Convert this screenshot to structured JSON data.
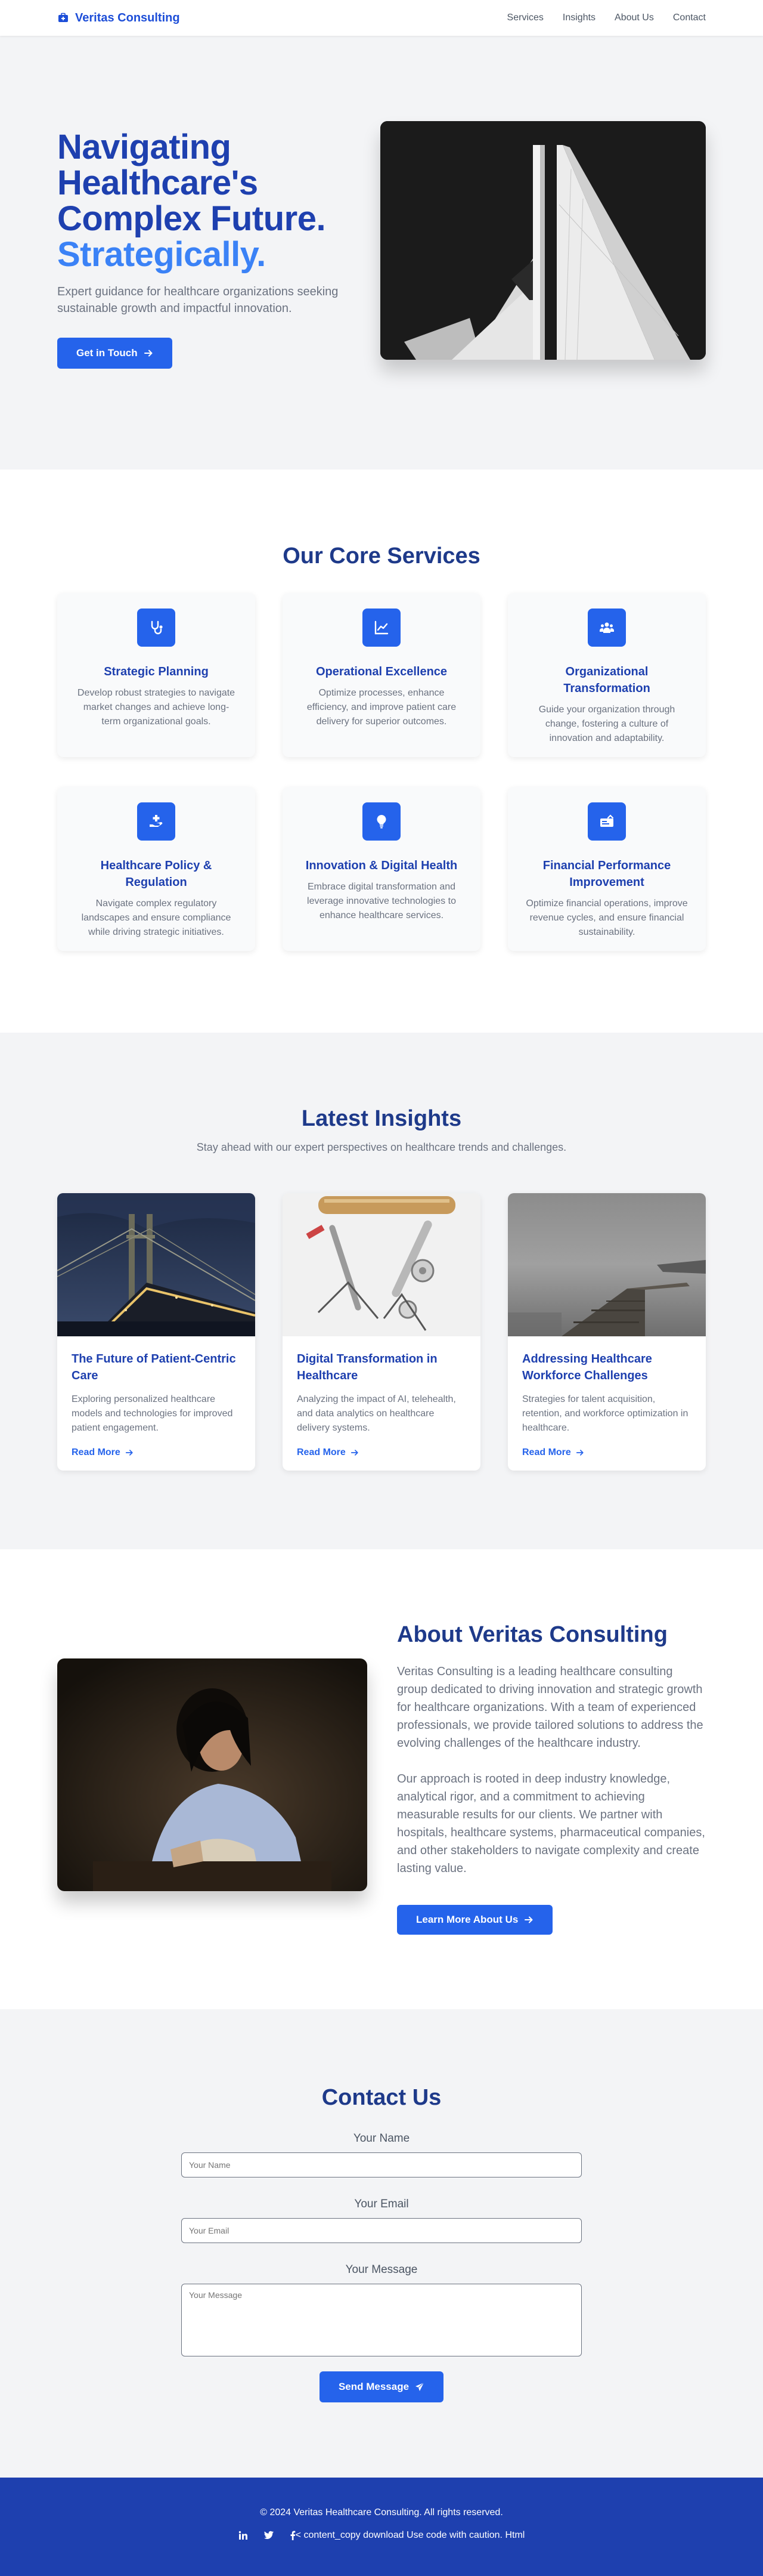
{
  "nav": {
    "brand": "Veritas Consulting",
    "links": [
      "Services",
      "Insights",
      "About Us",
      "Contact"
    ]
  },
  "hero": {
    "title": "Navigating Healthcare's Complex Future.",
    "title_accent": "Strategically.",
    "subtitle": "Expert guidance for healthcare organizations seeking sustainable growth and impactful innovation.",
    "cta": "Get in Touch"
  },
  "services": {
    "title": "Our Core Services",
    "items": [
      {
        "title": "Strategic Planning",
        "desc": "Develop robust strategies to navigate market changes and achieve long-term organizational goals.",
        "icon": "stethoscope-icon"
      },
      {
        "title": "Operational Excellence",
        "desc": "Optimize processes, enhance efficiency, and improve patient care delivery for superior outcomes.",
        "icon": "chart-line-icon"
      },
      {
        "title": "Organizational Transformation",
        "desc": "Guide your organization through change, fostering a culture of innovation and adaptability.",
        "icon": "people-group-icon"
      },
      {
        "title": "Healthcare Policy & Regulation",
        "desc": "Navigate complex regulatory landscapes and ensure compliance while driving strategic initiatives.",
        "icon": "hand-holding-medical-icon"
      },
      {
        "title": "Innovation & Digital Health",
        "desc": "Embrace digital transformation and leverage innovative technologies to enhance healthcare services.",
        "icon": "lightbulb-icon"
      },
      {
        "title": "Financial Performance Improvement",
        "desc": "Optimize financial operations, improve revenue cycles, and ensure financial sustainability.",
        "icon": "money-check-icon"
      }
    ]
  },
  "insights": {
    "title": "Latest Insights",
    "subtitle": "Stay ahead with our expert perspectives on healthcare trends and challenges.",
    "items": [
      {
        "title": "The Future of Patient-Centric Care",
        "desc": "Exploring personalized healthcare models and technologies for improved patient engagement.",
        "link": "Read More",
        "image": "bridge-at-night"
      },
      {
        "title": "Digital Transformation in Healthcare",
        "desc": "Analyzing the impact of AI, telehealth, and data analytics on healthcare delivery systems.",
        "link": "Read More",
        "image": "clamps-and-pipes"
      },
      {
        "title": "Addressing Healthcare Workforce Challenges",
        "desc": "Strategies for talent acquisition, retention, and workforce optimization in healthcare.",
        "link": "Read More",
        "image": "foggy-pier"
      }
    ]
  },
  "about": {
    "title": "About Veritas Consulting",
    "p1": "Veritas Consulting is a leading healthcare consulting group dedicated to driving innovation and strategic growth for healthcare organizations. With a team of experienced professionals, we provide tailored solutions to address the evolving challenges of the healthcare industry.",
    "p2": "Our approach is rooted in deep industry knowledge, analytical rigor, and a commitment to achieving measurable results for our clients. We partner with hospitals, healthcare systems, pharmaceutical companies, and other stakeholders to navigate complexity and create lasting value.",
    "cta": "Learn More About Us"
  },
  "contact": {
    "title": "Contact Us",
    "name_label": "Your Name",
    "name_placeholder": "Your Name",
    "email_label": "Your Email",
    "email_placeholder": "Your Email",
    "message_label": "Your Message",
    "message_placeholder": "Your Message",
    "submit": "Send Message"
  },
  "footer": {
    "copyright": "© 2024 Veritas Healthcare Consulting. All rights reserved.",
    "link_text": "< content_copy download Use code with caution. Html"
  },
  "colors": {
    "primary": "#2563eb",
    "heading": "#1e40af",
    "accent": "#3b82f6",
    "footer_bg": "#1e40af"
  }
}
